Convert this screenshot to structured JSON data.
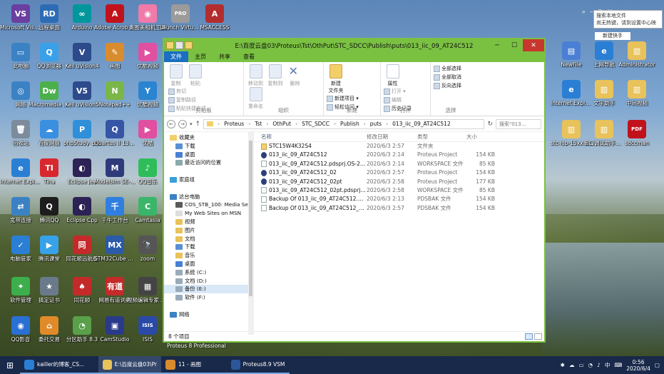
{
  "desktop": {
    "icons": [
      {
        "label": "Microsoft Visual Studio...",
        "color": "#6a3fa0",
        "glyph": "VS"
      },
      {
        "label": "远程桌面",
        "color": "#2d6cb5",
        "glyph": "RD"
      },
      {
        "label": "Arduino",
        "color": "#00979c",
        "glyph": "∞"
      },
      {
        "label": "Adobe Acrobat DC",
        "color": "#c1121c",
        "glyph": "A"
      },
      {
        "label": "奥图美相机工具",
        "color": "#f07aa8",
        "glyph": "◉"
      },
      {
        "label": "Launch Virtual Serial Po...",
        "color": "#9b9b9b",
        "glyph": "PRO"
      },
      {
        "label": "MSACCESS",
        "color": "#b32d2d",
        "glyph": "A"
      },
      {
        "label": "此电脑",
        "color": "#3b82c4",
        "glyph": "▭"
      },
      {
        "label": "QQ浏览器",
        "color": "#3aa0e8",
        "glyph": "Q"
      },
      {
        "label": "Keil uVision4",
        "color": "#2d4a8a",
        "glyph": "V"
      },
      {
        "label": "画图",
        "color": "#d98c2e",
        "glyph": "✎"
      },
      {
        "label": "优酷视频",
        "color": "#e14fa0",
        "glyph": "▶"
      },
      {
        "label": "网络",
        "color": "#3b82c4",
        "glyph": "◎"
      },
      {
        "label": "Macromedia Dreamwe...",
        "color": "#4bb04b",
        "glyph": "Dw"
      },
      {
        "label": "Keil uVision5",
        "color": "#2d4a8a",
        "glyph": "V5"
      },
      {
        "label": "Notepad++",
        "color": "#7ab648",
        "glyph": "N"
      },
      {
        "label": "优酷视频",
        "color": "#2a84d0",
        "glyph": "Y"
      },
      {
        "label": "回收站",
        "color": "#7c8c9c",
        "glyph": "🗑"
      },
      {
        "label": "百度网盘",
        "color": "#3a8fe0",
        "glyph": "☁"
      },
      {
        "label": "phpStudy_pro",
        "color": "#2f8fd8",
        "glyph": "P"
      },
      {
        "label": "Quartus II 13.0sp1 (64-...",
        "color": "#3656a5",
        "glyph": "Q"
      },
      {
        "label": "优酷",
        "color": "#e14fa0",
        "glyph": "▶"
      },
      {
        "label": "Internet Explorer",
        "color": "#2a7fd4",
        "glyph": "e"
      },
      {
        "label": "Tina",
        "color": "#d8282e",
        "glyph": "TI"
      },
      {
        "label": "Eclipse Jee",
        "color": "#2c2255",
        "glyph": "◐"
      },
      {
        "label": "Modelsim SE-64 10.4",
        "color": "#2f3a7a",
        "glyph": "M"
      },
      {
        "label": "QQ音乐",
        "color": "#2fbd5a",
        "glyph": "♪"
      },
      {
        "label": "宽带连接",
        "color": "#3b82c4",
        "glyph": "⇄"
      },
      {
        "label": "腾讯QQ",
        "color": "#1d1d1d",
        "glyph": "Q"
      },
      {
        "label": "Eclipse Cpp",
        "color": "#2c2255",
        "glyph": "◐"
      },
      {
        "label": "千牛工作台",
        "color": "#2f7fe0",
        "glyph": "千"
      },
      {
        "label": "Camtasia",
        "color": "#3bb56a",
        "glyph": "C"
      },
      {
        "label": "电脑管家",
        "color": "#2a7fd4",
        "glyph": "✓"
      },
      {
        "label": "腾讯课堂",
        "color": "#37a2e8",
        "glyph": "▶"
      },
      {
        "label": "同花顺远航版",
        "color": "#c42a2a",
        "glyph": "同"
      },
      {
        "label": "STM32Cube MX",
        "color": "#2a5aa8",
        "glyph": "MX"
      },
      {
        "label": "zoom",
        "color": "#555",
        "glyph": "🔭"
      },
      {
        "label": "软件管理",
        "color": "#3cae4b",
        "glyph": "✦"
      },
      {
        "label": "搞定证书",
        "color": "#6b7a8a",
        "glyph": "★"
      },
      {
        "label": "同花顺",
        "color": "#c42a2a",
        "glyph": "♠"
      },
      {
        "label": "网易有道词典",
        "color": "#c42a2a",
        "glyph": "有道"
      },
      {
        "label": "视频编辑专家 9.3",
        "color": "#444",
        "glyph": "▦"
      },
      {
        "label": "QQ影音",
        "color": "#2a6fd4",
        "glyph": "◉"
      },
      {
        "label": "委托交易",
        "color": "#e08a2a",
        "glyph": "⌂"
      },
      {
        "label": "分区助手 8.3",
        "color": "#5aa04a",
        "glyph": "◔"
      },
      {
        "label": "CamStudio",
        "color": "#2a3a8a",
        "glyph": "▣"
      },
      {
        "label": "ISIS",
        "color": "#2a4aa8",
        "glyph": "ISIS"
      },
      {
        "label": "NewFile",
        "color": "#4a7fd4",
        "glyph": "▤"
      },
      {
        "label": "上网导航",
        "color": "#2a7fd4",
        "glyph": "e"
      },
      {
        "label": "Administrator",
        "color": "#e8c25a",
        "glyph": "▥"
      },
      {
        "label": "Internet Explorer",
        "color": "#2a7fd4",
        "glyph": "e"
      },
      {
        "label": "文字助手",
        "color": "#e8c25a",
        "glyph": "▥"
      },
      {
        "label": "中间视频",
        "color": "#e8c25a",
        "glyph": "▥"
      },
      {
        "label": "stc-isp-15xx v6.87E",
        "color": "#e8c25a",
        "glyph": "▥"
      },
      {
        "label": "串口调试助手丁丁",
        "color": "#e8c25a",
        "glyph": "▥"
      },
      {
        "label": "sdccman",
        "color": "#c1121c",
        "glyph": "PDF"
      }
    ],
    "popup_title": "搜索本地文件",
    "popup_text": "尚无热键，请到设置中心映",
    "new_badge": "新建快手",
    "window_under_text": "Proteus 8 Professional"
  },
  "window": {
    "title": "E:\\百度云盘03\\Proteus\\Tst\\OthPut\\STC_SDCC\\Publish\\puts\\013_iic_09_AT24C512",
    "tabs": [
      "文件",
      "主页",
      "共享",
      "查看"
    ],
    "ribbon": {
      "clipboard": {
        "copy": "复制",
        "paste": "粘贴",
        "cut": "剪切",
        "copy_path": "复制路径",
        "paste_shortcut": "粘贴快捷方式",
        "group": "剪贴板"
      },
      "organize": {
        "move_to": "移动到",
        "copy_to": "复制到",
        "delete": "删除",
        "rename": "重命名",
        "group": "组织"
      },
      "new": {
        "new_folder": "新建\n文件夹",
        "new_item": "新建项目 ▾",
        "easy_access": "轻松访问 ▾",
        "group": "新建"
      },
      "open": {
        "properties": "属性",
        "open": "打开 ▾",
        "edit": "编辑",
        "history": "历史记录",
        "group": "打开"
      },
      "select": {
        "select_all": "全部选择",
        "select_none": "全部取消",
        "invert": "反向选择",
        "group": "选择"
      }
    },
    "breadcrumb": [
      "Proteus",
      "Tst",
      "OthPut",
      "STC_SDCC",
      "Publish",
      "puts",
      "013_iic_09_AT24C512"
    ],
    "search_placeholder": "搜索\"013...",
    "nav_tree": [
      {
        "label": "收藏夹",
        "color": "#f3cf6a"
      },
      {
        "label": "下载",
        "color": "#5a8fd6"
      },
      {
        "label": "桌面",
        "color": "#4a7fd4"
      },
      {
        "label": "最近访问的位置",
        "color": "#8aa"
      },
      {
        "label": "",
        "color": ""
      },
      {
        "label": "家庭组",
        "color": "#3a9fd8"
      },
      {
        "label": "",
        "color": ""
      },
      {
        "label": "这台电脑",
        "color": "#3b82c4"
      },
      {
        "label": "COS_STB_100: Media Server",
        "color": "#5a5a5a"
      },
      {
        "label": "My Web Sites on MSN",
        "color": "#ddd"
      },
      {
        "label": "视频",
        "color": "#e8c25a"
      },
      {
        "label": "图片",
        "color": "#e8c25a"
      },
      {
        "label": "文档",
        "color": "#e8c25a"
      },
      {
        "label": "下载",
        "color": "#5a8fd6"
      },
      {
        "label": "音乐",
        "color": "#e8c25a"
      },
      {
        "label": "桌面",
        "color": "#4a7fd4"
      },
      {
        "label": "系统 (C:)",
        "color": "#9ab"
      },
      {
        "label": "文档 (D:)",
        "color": "#9ab"
      },
      {
        "label": "备份 (E:)",
        "color": "#9ab"
      },
      {
        "label": "软件 (F:)",
        "color": "#9ab"
      },
      {
        "label": "",
        "color": ""
      },
      {
        "label": "网络",
        "color": "#3b82c4"
      }
    ],
    "columns": {
      "name": "名称",
      "date": "修改日期",
      "type": "类型",
      "size": "大小"
    },
    "files": [
      {
        "name": "STC15W4K32S4",
        "date": "2020/6/3 2:57",
        "type": "文件夹",
        "size": "",
        "icon": "folder"
      },
      {
        "name": "013_iic_09_AT24C512",
        "date": "2020/6/3 2:14",
        "type": "Proteus Project",
        "size": "154 KB",
        "icon": "proj"
      },
      {
        "name": "013_iic_09_AT24C512.pdsprj.OS-2020...",
        "date": "2020/6/3 2:14",
        "type": "WORKSPACE 文件",
        "size": "85 KB",
        "icon": "file"
      },
      {
        "name": "013_iic_09_AT24C512_02",
        "date": "2020/6/3 2:57",
        "type": "Proteus Project",
        "size": "154 KB",
        "icon": "proj"
      },
      {
        "name": "013_iic_09_AT24C512_02pt",
        "date": "2020/6/3 2:58",
        "type": "Proteus Project",
        "size": "177 KB",
        "icon": "proj"
      },
      {
        "name": "013_iic_09_AT24C512_02pt.pdsprj.OS-...",
        "date": "2020/6/3 2:58",
        "type": "WORKSPACE 文件",
        "size": "85 KB",
        "icon": "file"
      },
      {
        "name": "Backup Of 013_iic_09_AT24C512.pds...",
        "date": "2020/6/3 2:13",
        "type": "PDSBAK 文件",
        "size": "154 KB",
        "icon": "file"
      },
      {
        "name": "Backup Of 013_iic_09_AT24C512_02pt...",
        "date": "2020/6/3 2:57",
        "type": "PDSBAK 文件",
        "size": "154 KB",
        "icon": "file"
      }
    ],
    "status": "8 个项目"
  },
  "taskbar": {
    "items": [
      {
        "label": "kailler的博客_CS...",
        "color": "#2a7fd4"
      },
      {
        "label": "E:\\百度云盘03\\Pr...",
        "color": "#e8c25a"
      },
      {
        "label": "11 - 画图",
        "color": "#d98c2e"
      },
      {
        "label": "Proteus8.9 VSM...",
        "color": "#2b579a"
      }
    ],
    "tray_lang": "中",
    "time": "0:56",
    "date": "2020/6/4"
  }
}
